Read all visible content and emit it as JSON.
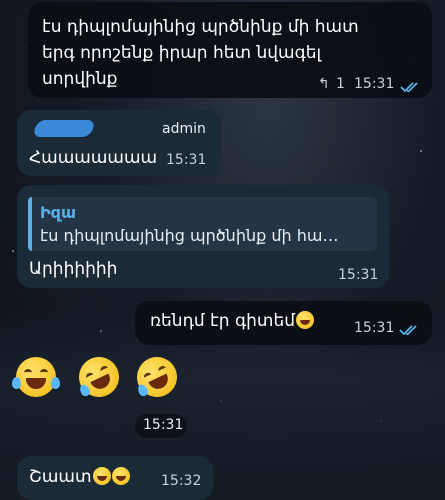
{
  "messages": {
    "m1": {
      "text_line1": "էս դիպլոմայինից պրծնինք մի հատ",
      "text_line2": "երգ որոշենք իրար հետ նվագել",
      "text_line3": "սորվինք",
      "reply_icon": "reply-arrow-icon",
      "reply_count": "1",
      "time": "15:31",
      "status_icon": "double-check-icon"
    },
    "m2": {
      "sender_tag": "admin",
      "text": "Հաաաաաաա",
      "time": "15:31"
    },
    "m3": {
      "quote_author": "Իզա",
      "quote_text": "էս դիպլոմայինից պրծնինք մի հա…",
      "text": "Արիիիիիի",
      "time": "15:31"
    },
    "m4": {
      "text": "ռենդմ էր գիտեմ",
      "emoji": "face-with-tears-of-joy",
      "time": "15:31",
      "status_icon": "double-check-icon"
    },
    "m5": {
      "emojis": [
        "face-with-tears-of-joy",
        "rolling-on-floor-laughing",
        "rolling-on-floor-laughing"
      ],
      "time": "15:31"
    },
    "m6": {
      "text": "Շաատ",
      "emojis": [
        "rolling-on-floor-laughing",
        "rolling-on-floor-laughing"
      ],
      "time": "15:32"
    }
  },
  "colors": {
    "accent": "#5ab0e6",
    "incoming_bubble": "#1b2a37",
    "outgoing_bubble": "#0a0e14"
  }
}
